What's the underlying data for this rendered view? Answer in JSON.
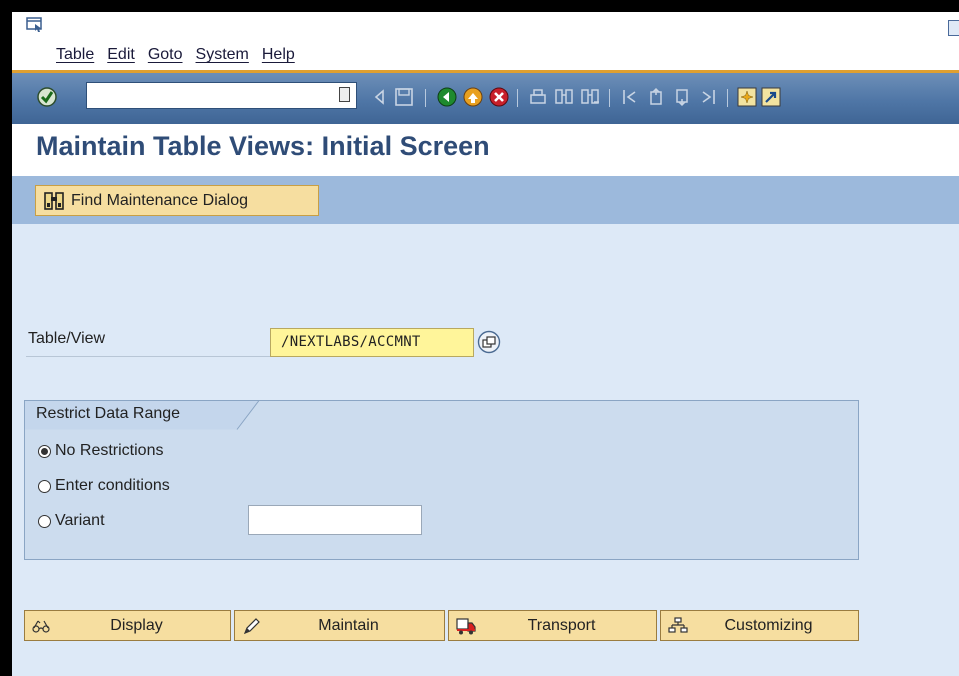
{
  "menu": [
    "Table",
    "Edit",
    "Goto",
    "System",
    "Help"
  ],
  "toolbar": {
    "command_value": "",
    "icons": [
      "enter-icon",
      "back-arrow-icon",
      "save-icon",
      "back-icon",
      "exit-icon",
      "cancel-icon",
      "print-icon",
      "find-icon",
      "find-next-icon",
      "first-page-icon",
      "previous-page-icon",
      "next-page-icon",
      "last-page-icon",
      "new-session-icon",
      "shortcut-icon"
    ]
  },
  "title": "Maintain Table Views: Initial Screen",
  "app_toolbar": {
    "find_label": "Find Maintenance Dialog"
  },
  "table_view": {
    "label": "Table/View",
    "value": "/NEXTLABS/ACCMNT"
  },
  "restrict": {
    "title": "Restrict Data Range",
    "options": [
      "No Restrictions",
      "Enter conditions",
      "Variant"
    ],
    "selected": "No Restrictions",
    "variant_value": ""
  },
  "buttons": [
    "Display",
    "Maintain",
    "Transport",
    "Customizing"
  ],
  "colors": {
    "title": "#2f4c77",
    "toolbar": "#4f76a6",
    "content": "#dde9f7",
    "button": "#f6dea0",
    "input_required": "#fff59a",
    "menu_rule": "#e0a030"
  }
}
